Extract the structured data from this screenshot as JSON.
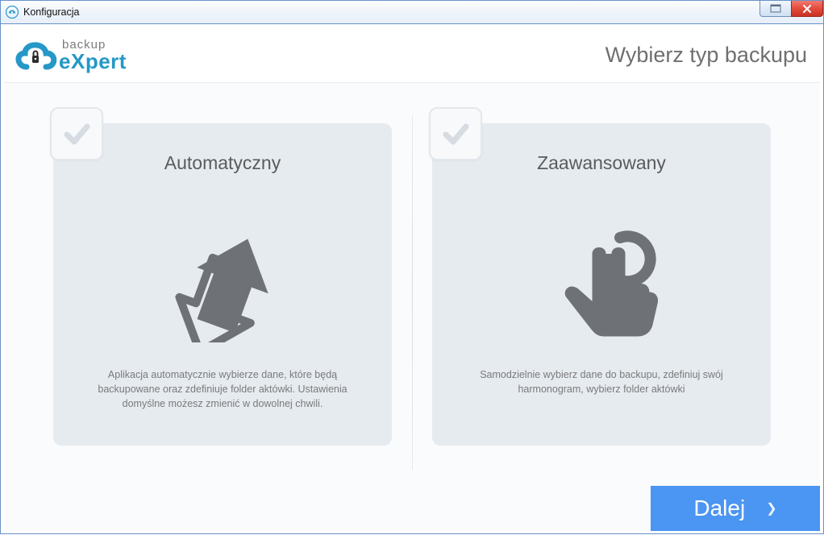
{
  "window": {
    "title": "Konfiguracja"
  },
  "brand": {
    "line1": "backup",
    "line2_a": "e",
    "line2_b": "X",
    "line2_c": "pert"
  },
  "page": {
    "title": "Wybierz typ backupu"
  },
  "cards": {
    "auto": {
      "title": "Automatyczny",
      "desc": "Aplikacja automatycznie wybierze dane, które będą backupowane oraz zdefiniuje folder aktówki. Ustawienia domyślne możesz zmienić w dowolnej chwili."
    },
    "adv": {
      "title": "Zaawansowany",
      "desc": "Samodzielnie wybierz dane do backupu, zdefiniuj swój harmonogram, wybierz folder aktówki"
    }
  },
  "footer": {
    "next": "Dalej"
  }
}
